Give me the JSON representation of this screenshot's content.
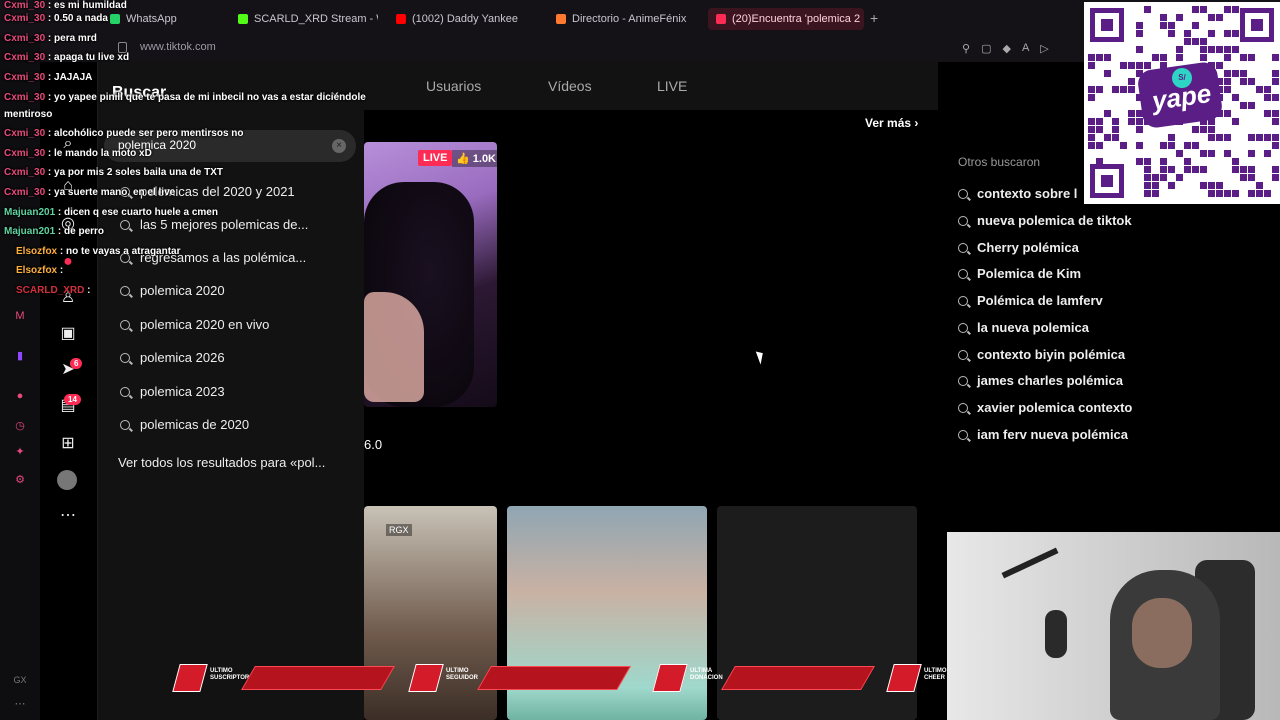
{
  "browser": {
    "tabs": [
      {
        "label": "WhatsApp",
        "color": "#25d366"
      },
      {
        "label": "SCARLD_XRD Stream - W",
        "color": "#53fc18"
      },
      {
        "label": "(1002) Daddy Yankee",
        "color": "#ff0000"
      },
      {
        "label": "Directorio - AnimeFénix",
        "color": "#ff7a30"
      },
      {
        "label": "(20)Encuentra 'polemica 2",
        "color": "#fe2c55"
      }
    ],
    "new_tab": "+",
    "url": "www.tiktok.com"
  },
  "tiktok": {
    "drawer": {
      "title": "Buscar",
      "close": "×",
      "search_value": "polemica 2020",
      "clear": "×",
      "suggestions": [
        "polemicas del 2020 y 2021",
        "las 5 mejores polemicas de...",
        "regresamos a las polémica...",
        "polemica 2020",
        "polemica 2020 en vivo",
        "polemica 2026",
        "polemica 2023",
        "polemicas de 2020"
      ],
      "see_all": "Ver todos los resultados para «pol..."
    },
    "rail": {
      "badge_messages": "6",
      "badge_inbox": "14"
    },
    "tabs": [
      "Usuarios",
      "Vídeos",
      "LIVE"
    ],
    "ver_mas": "Ver más ›",
    "live_card": {
      "badge": "LIVE",
      "likes": "1.0K",
      "count": "6.0"
    },
    "video_tag": "RGX",
    "others": {
      "title": "Otros buscaron",
      "items": [
        "contexto sobre l",
        "nueva polemica de tiktok",
        "Cherry polémica",
        "Polemica de Kim",
        "Polémica de lamferv",
        "la nueva polemica",
        "contexto biyin polémica",
        "james charles polémica",
        "xavier polemica contexto",
        "iam ferv nueva polémica"
      ]
    }
  },
  "overlay": {
    "chat": [
      {
        "user": "Cxmi_30",
        "text": " : es mi humildad",
        "color": "pink"
      },
      {
        "user": "Cxmi_30",
        "text": " : 0.50 a nada",
        "color": "pink"
      },
      {
        "user": "Cxmi_30",
        "text": " : pera mrd",
        "color": "pink"
      },
      {
        "user": "Cxmi_30",
        "text": " : apaga tu live xd",
        "color": "pink"
      },
      {
        "user": "Cxmi_30",
        "text": " : JAJAJA",
        "color": "pink"
      },
      {
        "user": "Cxmi_30",
        "text": " : yo yapee pinill que te pasa de mi inbecil no vas a estar diciéndole",
        "color": "pink"
      },
      {
        "user": "",
        "text": "mentiroso",
        "color": "pink"
      },
      {
        "user": "Cxmi_30",
        "text": " : alcohólico puede ser pero mentirsos no",
        "color": "pink"
      },
      {
        "user": "Cxmi_30",
        "text": " : le mando la moto xD",
        "color": "pink"
      },
      {
        "user": "Cxmi_30",
        "text": " : ya por mis 2 soles baila una de TXT",
        "color": "pink"
      },
      {
        "user": "Cxmi_30",
        "text": " : ya suerte mano, en el live",
        "color": "pink"
      },
      {
        "user": "Majuan201",
        "text": " : dicen q ese cuarto huele a cmen",
        "color": "green"
      },
      {
        "user": "Majuan201",
        "text": " : de perro",
        "color": "green"
      },
      {
        "user": "Elsozfox",
        "text": " : no te vayas a atragantar",
        "color": "orange"
      },
      {
        "user": "Elsozfox",
        "text": " : ",
        "color": "orange"
      },
      {
        "user": "SCARLD_XRD",
        "text": " : ",
        "color": "red"
      }
    ],
    "alerts": [
      {
        "label": "ULTIMO SUSCRIPTOR"
      },
      {
        "label": "ULTIMO SEGUIDOR"
      },
      {
        "label": "ULTIMA DONACION"
      },
      {
        "label": "ULTIMO CHEER"
      }
    ],
    "qr": {
      "brand": "yape",
      "coin": "S/"
    },
    "gx_label": "GX"
  }
}
